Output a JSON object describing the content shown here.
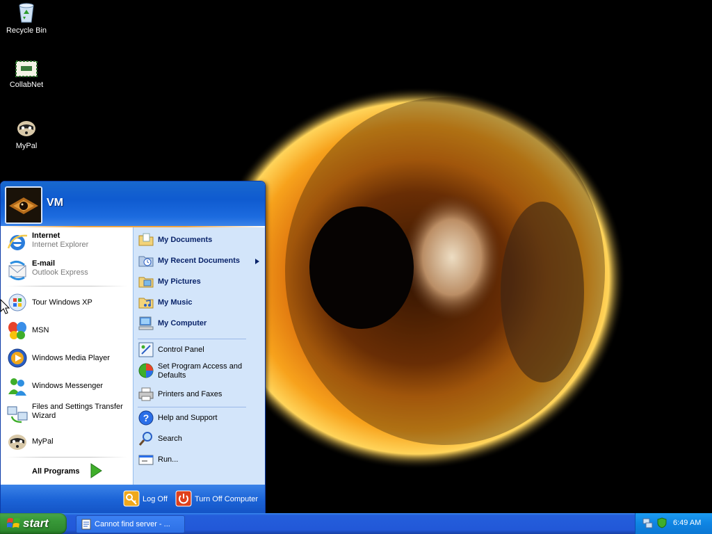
{
  "desktop": {
    "icons": [
      {
        "label": "Recycle Bin",
        "icon": "recycle-bin-icon"
      },
      {
        "label": "CollabNet",
        "icon": "collabnet-icon"
      },
      {
        "label": "MyPal",
        "icon": "mypal-icon"
      }
    ]
  },
  "start_menu": {
    "user_name": "VM",
    "pinned": [
      {
        "title": "Internet",
        "subtitle": "Internet Explorer",
        "icon": "internet-explorer-icon"
      },
      {
        "title": "E-mail",
        "subtitle": "Outlook Express",
        "icon": "outlook-express-icon"
      }
    ],
    "recent": [
      {
        "label": "Tour Windows XP",
        "icon": "tour-windows-icon"
      },
      {
        "label": "MSN",
        "icon": "msn-butterfly-icon"
      },
      {
        "label": "Windows Media Player",
        "icon": "media-player-icon"
      },
      {
        "label": "Windows Messenger",
        "icon": "messenger-icon"
      },
      {
        "label": "Files and Settings Transfer Wizard",
        "icon": "transfer-wizard-icon"
      },
      {
        "label": "MyPal",
        "icon": "mypal-icon"
      }
    ],
    "all_programs": "All Programs",
    "places": [
      {
        "label": "My Documents",
        "icon": "folder-documents-icon"
      },
      {
        "label": "My Recent Documents",
        "icon": "recent-documents-icon"
      },
      {
        "label": "My Pictures",
        "icon": "folder-pictures-icon"
      },
      {
        "label": "My Music",
        "icon": "folder-music-icon"
      },
      {
        "label": "My Computer",
        "icon": "computer-icon"
      }
    ],
    "settings": [
      {
        "label": "Control Panel",
        "icon": "control-panel-icon"
      },
      {
        "label": "Set Program Access and Defaults",
        "icon": "program-access-icon"
      },
      {
        "label": "Printers and Faxes",
        "icon": "printer-icon"
      }
    ],
    "tools": [
      {
        "label": "Help and Support",
        "icon": "help-icon"
      },
      {
        "label": "Search",
        "icon": "search-icon"
      },
      {
        "label": "Run...",
        "icon": "run-icon"
      }
    ],
    "log_off": "Log Off",
    "turn_off": "Turn Off Computer"
  },
  "taskbar": {
    "start_label": "start",
    "task_label": "Cannot find server - ...",
    "clock": "6:49 AM"
  },
  "colors": {
    "start_green": "#3a9b3a",
    "taskbar_blue": "#245edb",
    "menu_right_panel": "#d3e5fa",
    "header_blue": "#0f5bd0"
  }
}
